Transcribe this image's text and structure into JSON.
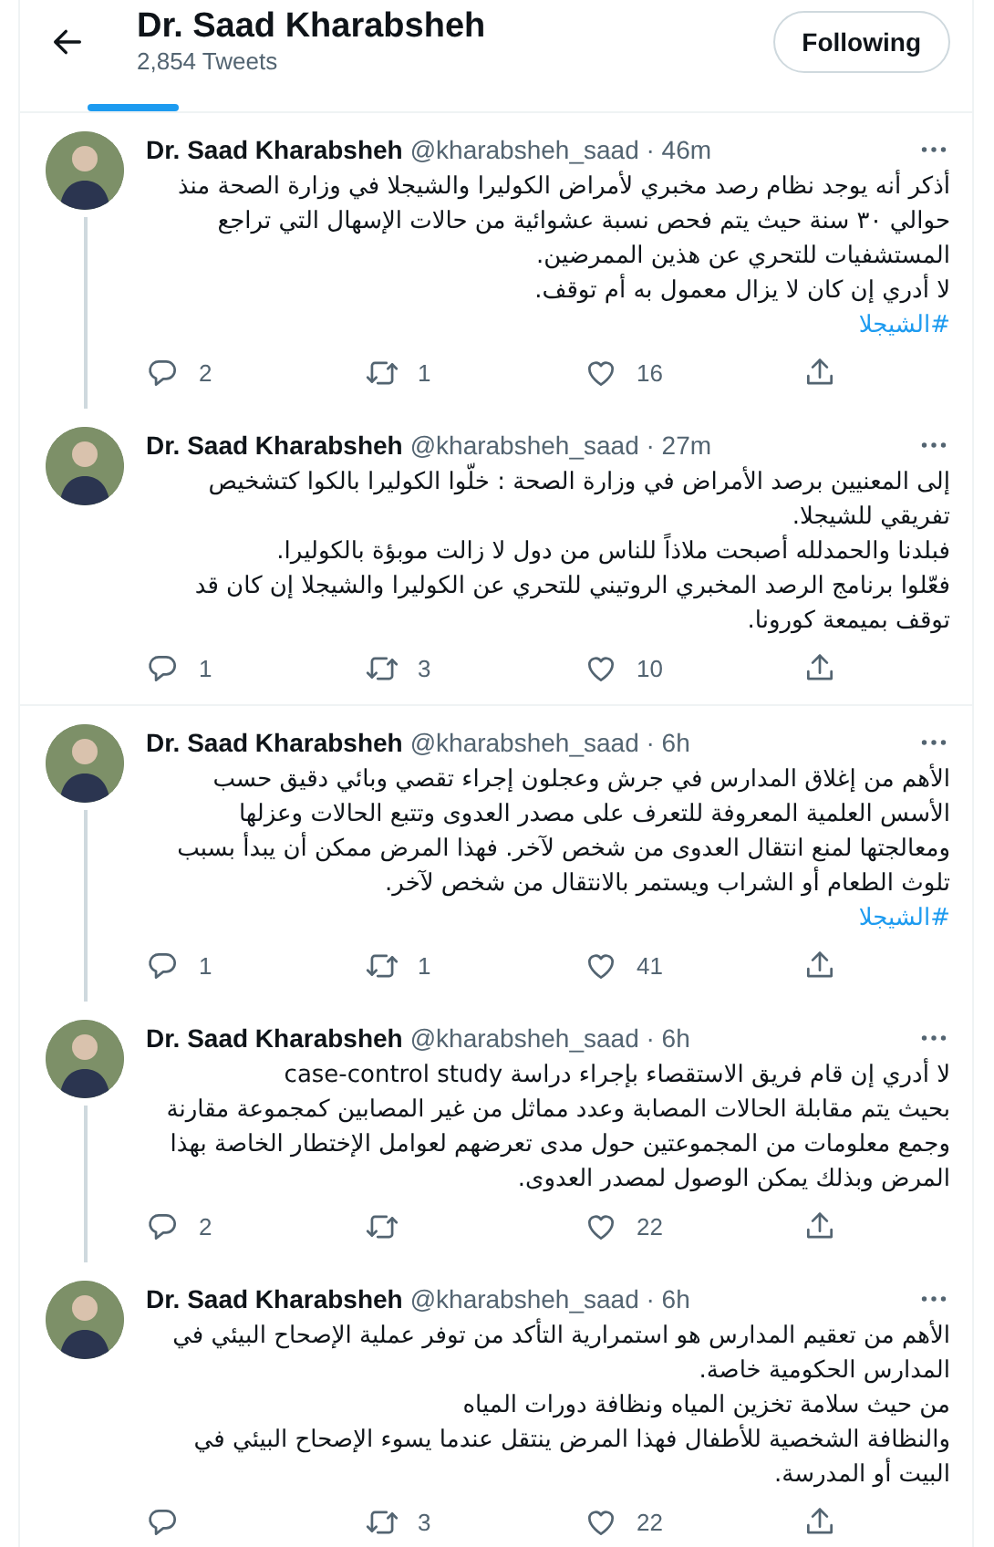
{
  "header": {
    "title": "Dr. Saad Kharabsheh",
    "tweet_count": "2,854 Tweets",
    "follow_button": "Following"
  },
  "tweets": [
    {
      "author": "Dr. Saad Kharabsheh",
      "handle_and_time": "@kharabsheh_saad · 46m",
      "text": "أذكر أنه يوجد نظام رصد مخبري لأمراض الكوليرا والشيجلا في وزارة الصحة منذ حوالي ٣٠ سنة حيث يتم فحص نسبة عشوائية من حالات الإسهال التي تراجع المستشفيات للتحري عن هذين الممرضين.\nلا أدري إن كان لا يزال معمول به أم توقف.",
      "hashtag": "#الشيجلا",
      "replies": "2",
      "retweets": "1",
      "likes": "16",
      "thread_continues": true
    },
    {
      "author": "Dr. Saad Kharabsheh",
      "handle_and_time": "@kharabsheh_saad · 27m",
      "text": "إلى المعنيين برصد الأمراض في وزارة الصحة : خلّوا الكوليرا بالكوا كتشخيص تفريقي للشيجلا.\nفبلدنا والحمدلله أصبحت ملاذاً للناس من دول لا زالت موبؤة بالكوليرا.\nفعّلوا برنامج الرصد المخبري الروتيني للتحري عن الكوليرا والشيجلا إن كان قد توقف بميمعة كورونا.",
      "replies": "1",
      "retweets": "3",
      "likes": "10",
      "thread_continues": false
    },
    {
      "author": "Dr. Saad Kharabsheh",
      "handle_and_time": "@kharabsheh_saad · 6h",
      "text": "الأهم من إغلاق المدارس في جرش وعجلون إجراء تقصي وبائي دقيق حسب الأسس العلمية المعروفة للتعرف على مصدر العدوى وتتبع الحالات وعزلها ومعالجتها لمنع انتقال العدوى من شخص لآخر. فهذا المرض ممكن أن يبدأ بسبب تلوث الطعام أو الشراب ويستمر بالانتقال من شخص لآخر.",
      "hashtag": "#الشيجلا",
      "replies": "1",
      "retweets": "1",
      "likes": "41",
      "thread_continues": true
    },
    {
      "author": "Dr. Saad Kharabsheh",
      "handle_and_time": "@kharabsheh_saad · 6h",
      "text": "لا أدري إن قام فريق الاستقصاء بإجراء دراسة case-control study\nبحيث يتم مقابلة الحالات المصابة وعدد مماثل من غير المصابين كمجموعة مقارنة وجمع معلومات من المجموعتين حول مدى تعرضهم لعوامل الإختطار الخاصة بهذا المرض وبذلك يمكن الوصول لمصدر العدوى.",
      "replies": "2",
      "likes": "22",
      "thread_continues": true
    },
    {
      "author": "Dr. Saad Kharabsheh",
      "handle_and_time": "@kharabsheh_saad · 6h",
      "text": "الأهم من تعقيم المدارس هو استمرارية التأكد من توفر عملية الإصحاح البيئي في المدارس الحكومية خاصة.\nمن حيث سلامة تخزين المياه ونظافة دورات المياه\nوالنظافة الشخصية للأطفال فهذا المرض ينتقل عندما يسوء الإصحاح البيئي في البيت أو المدرسة.",
      "retweets": "3",
      "likes": "22",
      "thread_continues": false
    }
  ]
}
